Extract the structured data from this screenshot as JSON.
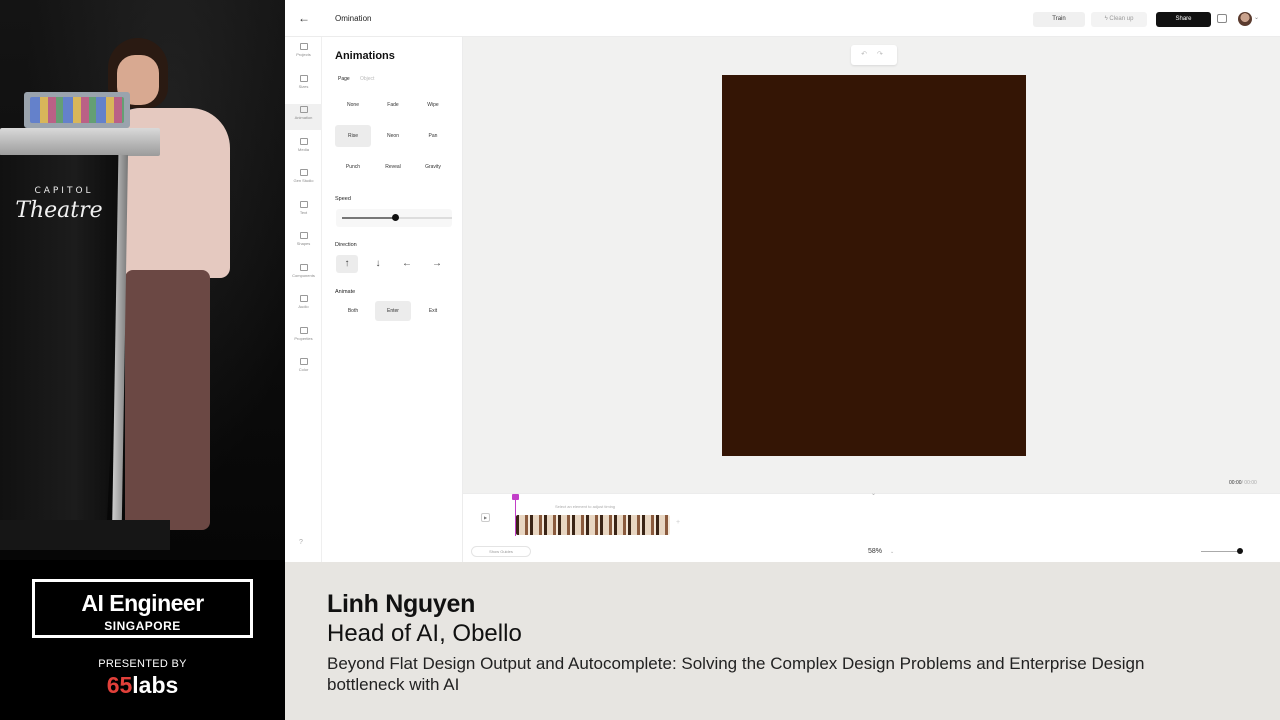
{
  "venue": {
    "line1": "CAPITOL",
    "line2": "Theatre"
  },
  "branding": {
    "event_title": "AI Engineer",
    "event_location": "SINGAPORE",
    "presented_by": "PRESENTED BY",
    "sponsor_number": "65",
    "sponsor_word": "labs"
  },
  "lower_third": {
    "name": "Linh Nguyen",
    "role": "Head of AI, Obello",
    "talk_title": "Beyond Flat Design Output and Autocomplete: Solving the Complex Design Problems and Enterprise Design bottleneck with AI"
  },
  "app": {
    "topbar": {
      "project_title": "Omination",
      "train_label": "Train",
      "cleanup_label": "Clean up",
      "share_label": "Share"
    },
    "rail": {
      "items": [
        {
          "label": "Projects"
        },
        {
          "label": "Sizes"
        },
        {
          "label": "Animation"
        },
        {
          "label": "Media"
        },
        {
          "label": "Gen Studio"
        },
        {
          "label": "Text"
        },
        {
          "label": "Shapes"
        },
        {
          "label": "Components"
        },
        {
          "label": "Audio"
        },
        {
          "label": "Properties"
        },
        {
          "label": "Color"
        }
      ],
      "help": "?"
    },
    "panel": {
      "title": "Animations",
      "tabs": {
        "page": "Page",
        "object": "Object"
      },
      "animations": [
        "None",
        "Fade",
        "Wipe",
        "Rise",
        "Neon",
        "Pan",
        "Punch",
        "Reveal",
        "Gravity"
      ],
      "selected_animation": "Rise",
      "speed_label": "Speed",
      "speed_value": 0.48,
      "direction_label": "Direction",
      "directions": [
        "↑",
        "↓",
        "←",
        "→"
      ],
      "animate_label": "Animate",
      "animate_options": [
        "Both",
        "Enter",
        "Exit"
      ],
      "selected_animate": "Enter"
    },
    "canvas": {
      "undo_redo": "↶ ↷",
      "artboard_color": "#341505",
      "time_current": "00:00",
      "time_total": "/ 00:00"
    },
    "timeline": {
      "hint": "Select an element to adjust timing",
      "show_guides": "Show Guides",
      "zoom": "58%"
    }
  }
}
